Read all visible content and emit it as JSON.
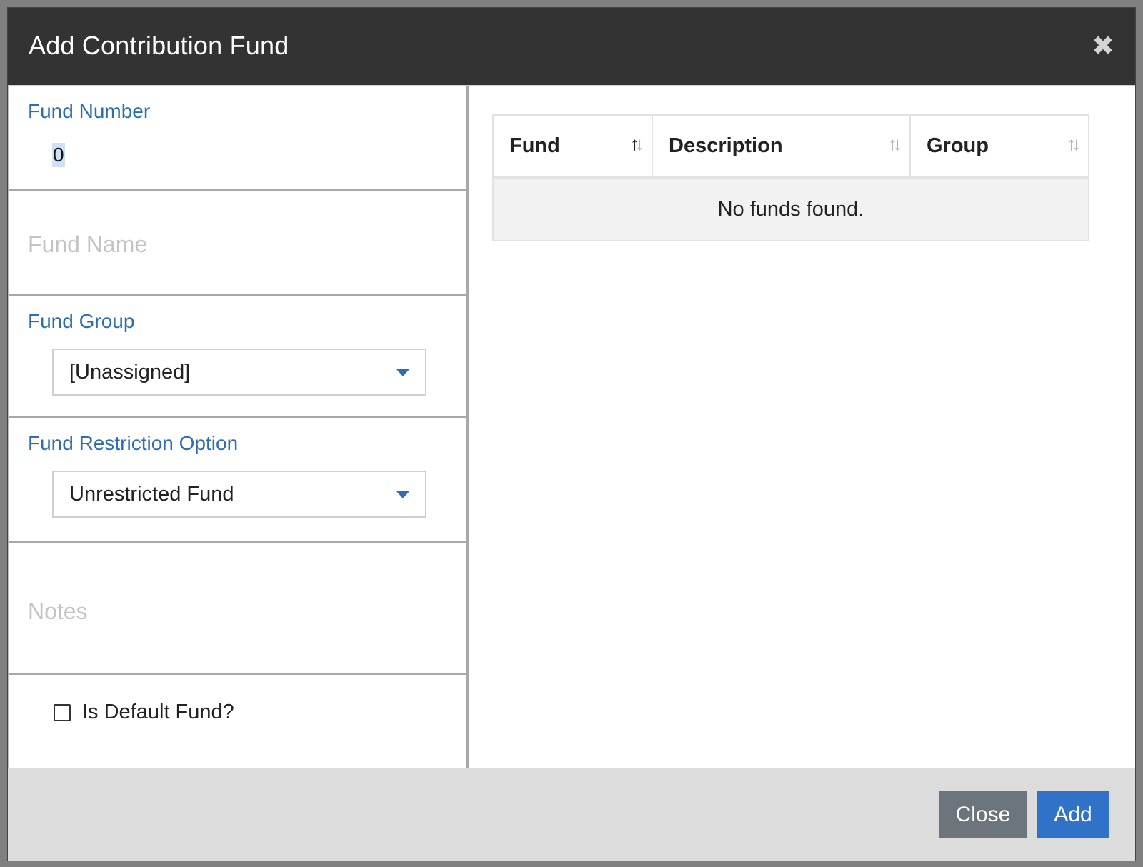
{
  "dialog": {
    "title": "Add Contribution Fund",
    "close_icon": "close-icon"
  },
  "form": {
    "fund_number": {
      "label": "Fund Number",
      "value": "0"
    },
    "fund_name": {
      "placeholder": "Fund Name"
    },
    "fund_group": {
      "label": "Fund Group",
      "selected": "[Unassigned]"
    },
    "fund_restriction": {
      "label": "Fund Restriction Option",
      "selected": "Unrestricted Fund"
    },
    "notes": {
      "placeholder": "Notes"
    },
    "is_default": {
      "label": "Is Default Fund?",
      "checked": false
    }
  },
  "table": {
    "columns": [
      {
        "label": "Fund",
        "sort_icon": "sort-ascending-icon"
      },
      {
        "label": "Description",
        "sort_icon": "sort-icon"
      },
      {
        "label": "Group",
        "sort_icon": "sort-icon"
      }
    ],
    "empty_message": "No funds found."
  },
  "footer": {
    "close_label": "Close",
    "add_label": "Add"
  },
  "colors": {
    "header_bg": "#333333",
    "label_blue": "#2f6db3",
    "add_button": "#2f72c8",
    "close_button": "#6c747c"
  }
}
